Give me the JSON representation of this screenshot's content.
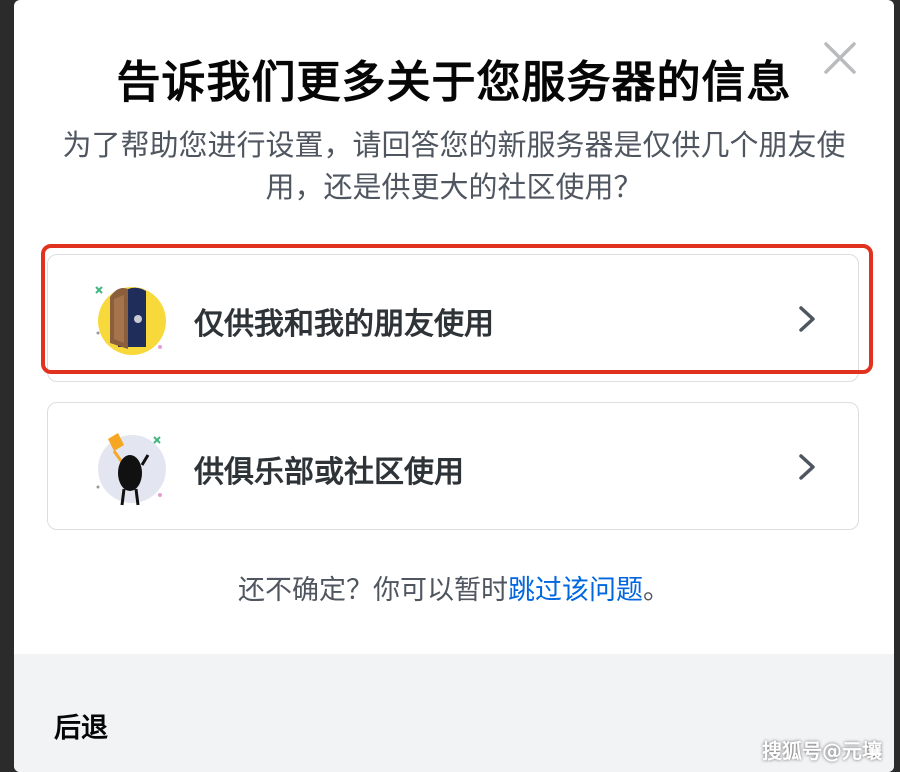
{
  "modal": {
    "title": "告诉我们更多关于您服务器的信息",
    "subtitle": "为了帮助您进行设置，请回答您的新服务器是仅供几个朋友使用，还是供更大的社区使用？",
    "close_icon": "close-icon",
    "options": [
      {
        "label": "仅供我和我的朋友使用",
        "icon": "door-illustration-icon",
        "selected": true
      },
      {
        "label": "供俱乐部或社区使用",
        "icon": "flag-character-illustration-icon",
        "selected": false
      }
    ],
    "hint_prefix": "还不确定？你可以暂时",
    "hint_link": "跳过该问题",
    "hint_suffix": "。",
    "back_label": "后退"
  },
  "watermark": "搜狐号@元壤",
  "colors": {
    "highlight": "#e0321e",
    "link": "#0067e0",
    "title": "#060607"
  }
}
